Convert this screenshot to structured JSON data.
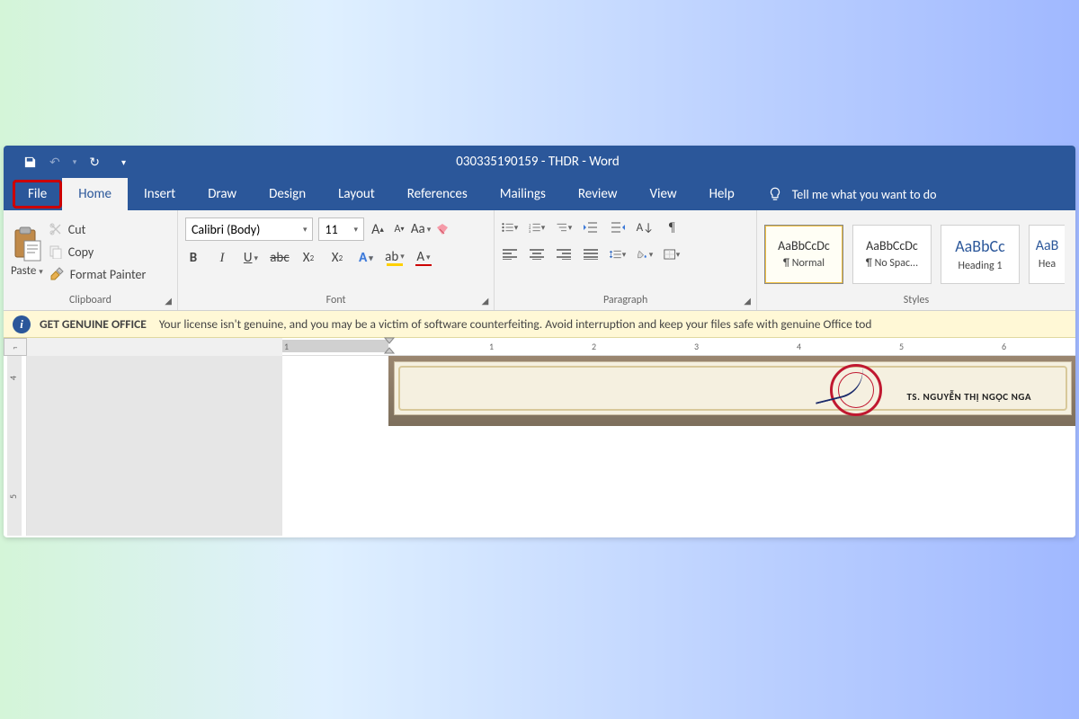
{
  "window": {
    "title": "030335190159 - THDR  -  Word"
  },
  "tabs": {
    "file": "File",
    "home": "Home",
    "insert": "Insert",
    "draw": "Draw",
    "design": "Design",
    "layout": "Layout",
    "references": "References",
    "mailings": "Mailings",
    "review": "Review",
    "view": "View",
    "help": "Help"
  },
  "tellme": "Tell me what you want to do",
  "clipboard": {
    "paste": "Paste",
    "cut": "Cut",
    "copy": "Copy",
    "format_painter": "Format Painter",
    "group": "Clipboard"
  },
  "font": {
    "name": "Calibri (Body)",
    "size": "11",
    "group": "Font",
    "clear": "Clear",
    "aa": "Aa"
  },
  "paragraph": {
    "group": "Paragraph"
  },
  "styles": {
    "group": "Styles",
    "items": [
      {
        "preview": "AaBbCcDc",
        "label": "¶ Normal"
      },
      {
        "preview": "AaBbCcDc",
        "label": "¶ No Spac..."
      },
      {
        "preview": "AaBbCc",
        "label": "Heading 1"
      },
      {
        "preview": "AaB",
        "label": "Hea"
      }
    ]
  },
  "warning": {
    "title": "GET GENUINE OFFICE",
    "body": "Your license isn't genuine, and you may be a victim of software counterfeiting. Avoid interruption and keep your files safe with genuine Office tod"
  },
  "ruler": {
    "nums": [
      "1",
      "1",
      "2",
      "3",
      "4",
      "5",
      "6"
    ]
  },
  "vruler": {
    "nums": [
      "4",
      "5"
    ]
  },
  "certificate": {
    "name": "TS. NGUYỄN THỊ NGỌC NGA"
  }
}
